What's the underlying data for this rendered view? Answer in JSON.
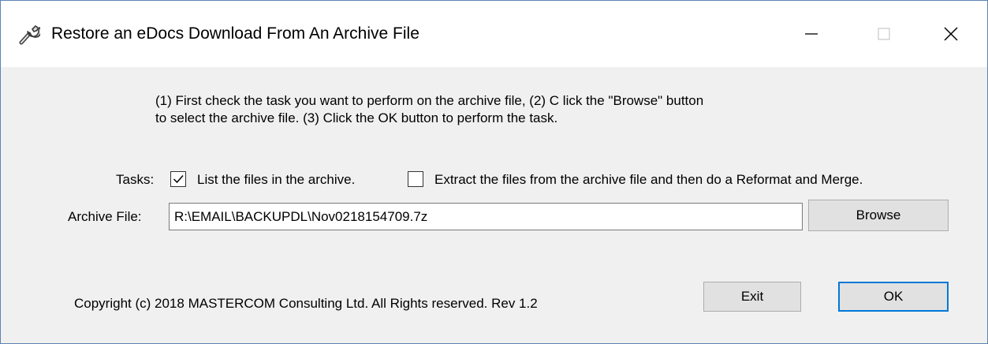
{
  "window": {
    "title": "Restore an eDocs Download From An Archive File",
    "icon": "wrench-icon"
  },
  "instructions": "(1) First check the task you want to perform on the archive file, (2) C lick the \"Browse\" button\n to select the archive file. (3) Click the OK button to perform the task.",
  "tasks": {
    "label": "Tasks:",
    "options": [
      {
        "label": "List the files in the archive.",
        "checked": true
      },
      {
        "label": "Extract the files from the archive file and then do a Reformat and Merge.",
        "checked": false
      }
    ]
  },
  "archive": {
    "label": "Archive File:",
    "value": "R:\\EMAIL\\BACKUPDL\\Nov0218154709.7z",
    "browse_label": "Browse"
  },
  "footer": {
    "copyright": "Copyright (c) 2018 MASTERCOM Consulting Ltd. All Rights reserved.   Rev 1.2",
    "exit_label": "Exit",
    "ok_label": "OK"
  },
  "colors": {
    "window_border": "#5b84b1",
    "client_bg": "#f0f0f0",
    "default_button_border": "#0078d7",
    "button_bg": "#e1e1e1"
  }
}
